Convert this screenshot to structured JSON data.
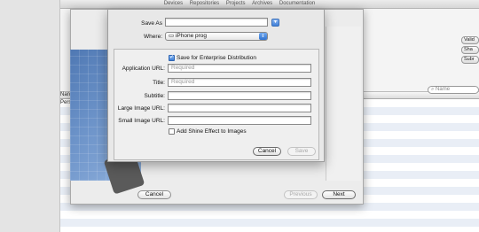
{
  "background": {
    "tabs": [
      "Devices",
      "Repositories",
      "Projects",
      "Archives",
      "Documentation"
    ],
    "side_buttons": [
      "Valid",
      "Sha",
      "Subr"
    ],
    "table_headers": [
      "Nan",
      "Pers"
    ],
    "search": {
      "placeholder": "Name"
    }
  },
  "save_dialog": {
    "save_as_label": "Save As",
    "save_as_value": "",
    "where_label": "Where:",
    "where_value": "iPhone prog",
    "enterprise_checkbox_label": "Save for Enterprise Distribution",
    "enterprise_checked": true,
    "fields": [
      {
        "label": "Application URL:",
        "placeholder": "Required"
      },
      {
        "label": "Title:",
        "placeholder": "Required"
      },
      {
        "label": "Subtitle:",
        "placeholder": ""
      },
      {
        "label": "Large Image URL:",
        "placeholder": ""
      },
      {
        "label": "Small Image URL:",
        "placeholder": ""
      }
    ],
    "shine_checkbox_label": "Add Shine Effect to Images",
    "shine_checked": false,
    "cancel_label": "Cancel",
    "save_label": "Save"
  },
  "sheet": {
    "cancel_label": "Cancel",
    "previous_label": "Previous",
    "next_label": "Next"
  },
  "colors": {
    "accent": "#3c7fd8",
    "sheet_bg": "#ececec"
  }
}
